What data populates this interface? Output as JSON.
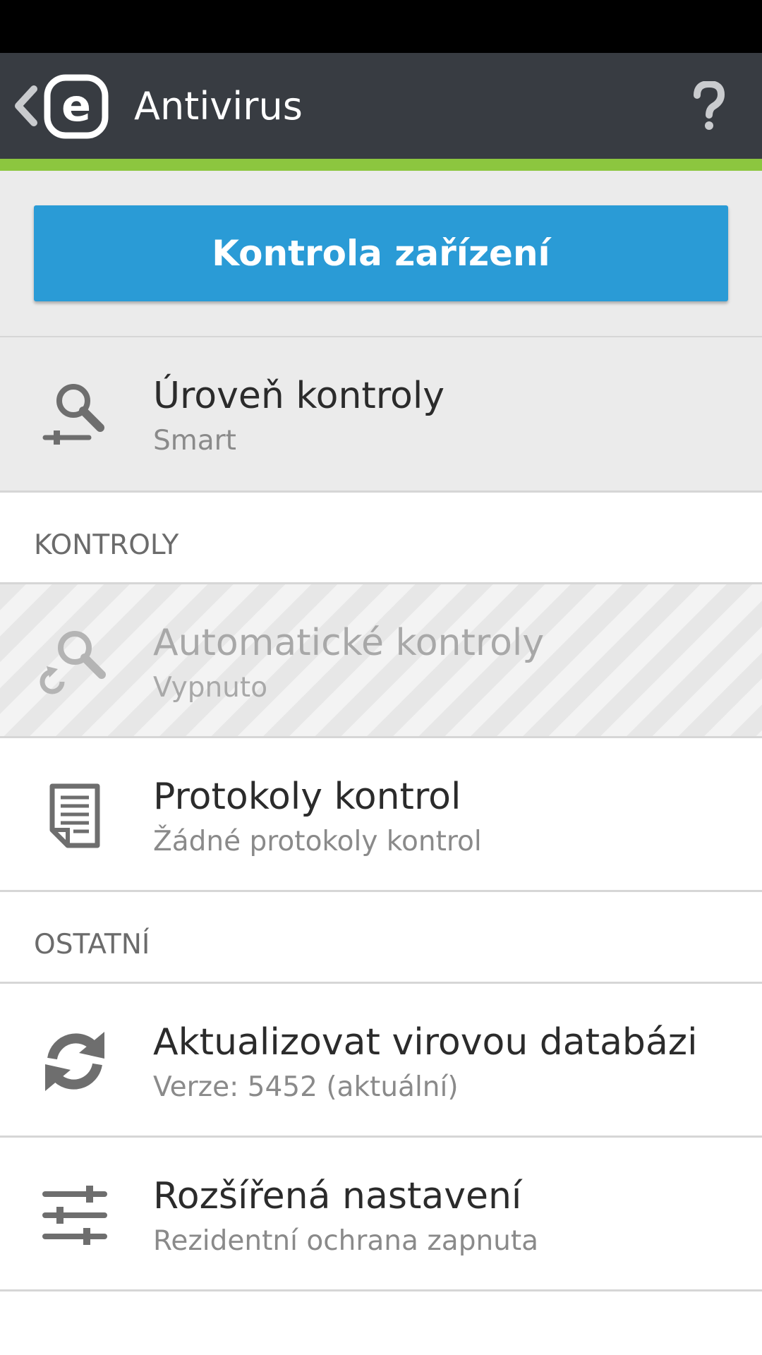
{
  "app_bar": {
    "title": "Antivirus",
    "logo_letter": "e"
  },
  "scan_button": {
    "label": "Kontrola zařízení"
  },
  "scan_level": {
    "title": "Úroveň kontroly",
    "value": "Smart"
  },
  "sections": {
    "kontroly": "KONTROLY",
    "ostatni": "OSTATNÍ"
  },
  "items": {
    "auto_scans": {
      "title": "Automatické kontroly",
      "subtitle": "Vypnuto",
      "enabled": false
    },
    "scan_logs": {
      "title": "Protokoly kontrol",
      "subtitle": "Žádné protokoly kontrol"
    },
    "update_db": {
      "title": "Aktualizovat virovou databázi",
      "subtitle": "Verze: 5452 (aktuální)"
    },
    "advanced": {
      "title": "Rozšířená nastavení",
      "subtitle": "Rezidentní ochrana zapnuta"
    }
  },
  "icons": {
    "back": "chevron-left-icon",
    "logo": "eset-logo-icon",
    "help": "help-icon",
    "scan_level": "magnifier-slider-icon",
    "auto_scans": "magnifier-refresh-icon",
    "scan_logs": "document-icon",
    "update_db": "refresh-icon",
    "advanced": "sliders-icon"
  },
  "colors": {
    "app_bar": "#383c42",
    "accent": "#8cc63f",
    "button": "#2a9bd6",
    "icon_gray": "#6e6e6e"
  }
}
